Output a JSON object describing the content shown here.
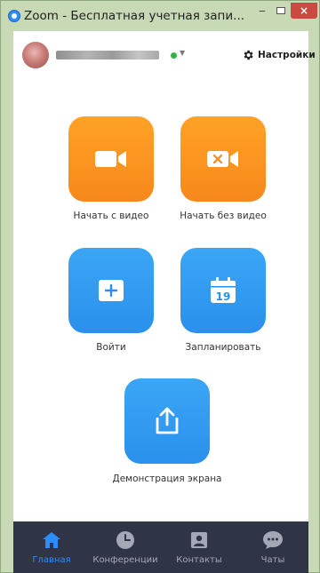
{
  "window": {
    "title": "Zoom - Бесплатная учетная запи...",
    "minimize_symbol": "‒",
    "close_symbol": "×"
  },
  "header": {
    "status": "online",
    "status_color": "#33b445",
    "settings_label": "Настройки"
  },
  "actions": [
    {
      "id": "start-with-video",
      "label": "Начать с видео",
      "icon": "video-camera-icon",
      "color": "#f7881b"
    },
    {
      "id": "start-without-video",
      "label": "Начать без видео",
      "icon": "video-camera-off-icon",
      "color": "#f7881b"
    },
    {
      "id": "join",
      "label": "Войти",
      "icon": "plus-icon",
      "color": "#2d8cff"
    },
    {
      "id": "schedule",
      "label": "Запланировать",
      "icon": "calendar-icon",
      "color": "#2d8cff",
      "calendar_day": "19"
    },
    {
      "id": "share-screen",
      "label": "Демонстрация экрана",
      "icon": "share-up-arrow-icon",
      "color": "#2d8cff"
    }
  ],
  "nav": {
    "items": [
      {
        "label": "Главная",
        "icon": "home-icon",
        "active": true
      },
      {
        "label": "Конференции",
        "icon": "clock-icon",
        "active": false
      },
      {
        "label": "Контакты",
        "icon": "contact-card-icon",
        "active": false
      },
      {
        "label": "Чаты",
        "icon": "chat-bubble-icon",
        "active": false
      }
    ],
    "active_color": "#2d8cff"
  }
}
